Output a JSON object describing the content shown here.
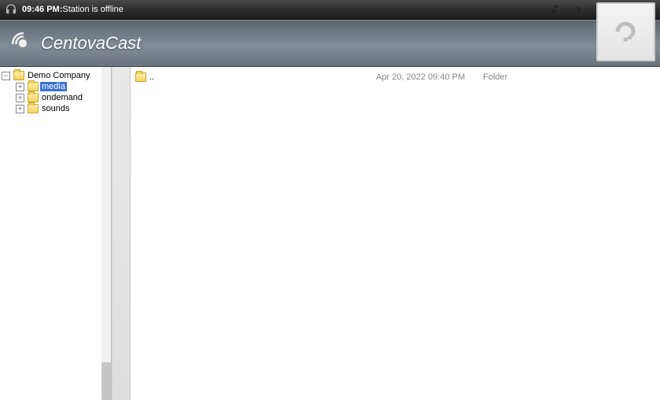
{
  "status": {
    "time": "09:46 PM:",
    "text": " Station is offline"
  },
  "brand": {
    "name_bold": "Centova",
    "name_light": "Cast"
  },
  "tree": {
    "root": {
      "label": "Demo Company",
      "expanded": true
    },
    "children": [
      {
        "label": "media",
        "selected": true
      },
      {
        "label": "ondemand",
        "selected": false
      },
      {
        "label": "sounds",
        "selected": false
      }
    ]
  },
  "files": {
    "rows": [
      {
        "name": "..",
        "date": "Apr 20, 2022 09:40 PM",
        "type": "Folder"
      }
    ]
  },
  "glyph": {
    "minus": "−",
    "plus": "+"
  }
}
